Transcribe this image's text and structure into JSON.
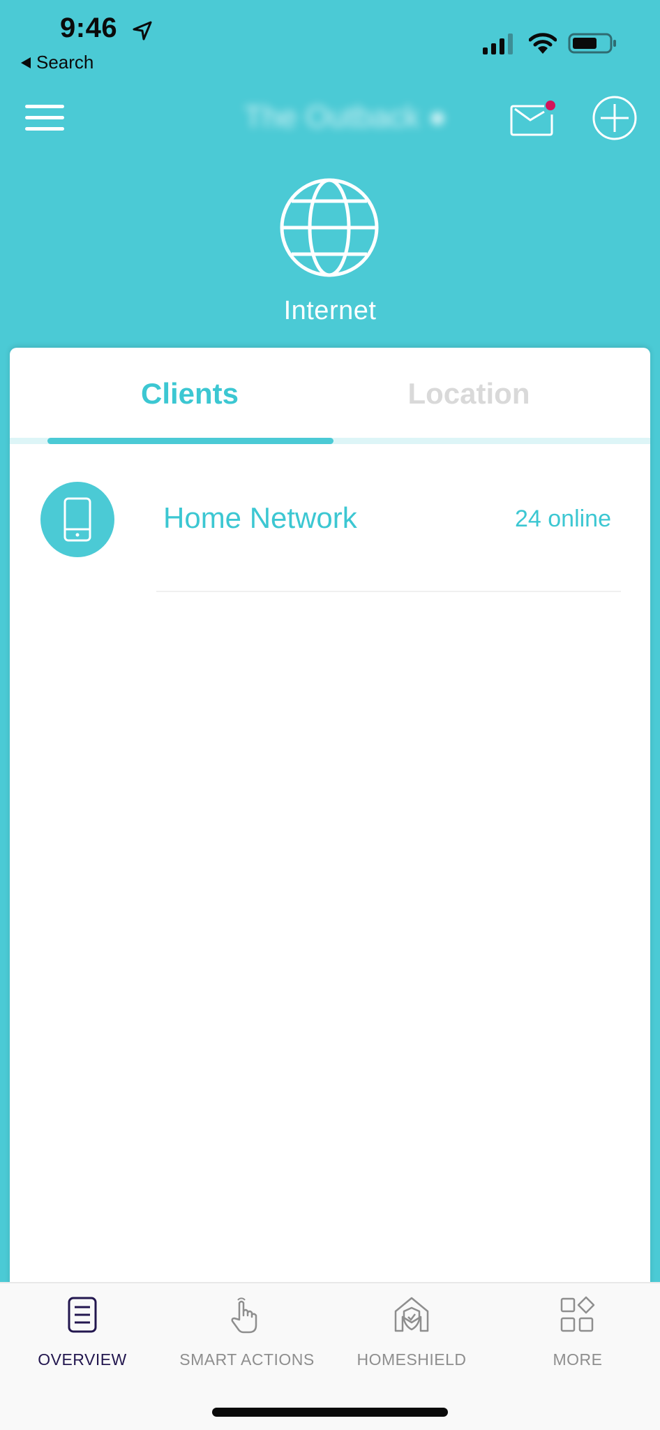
{
  "status_bar": {
    "time": "9:46",
    "back_label": "Search",
    "icons": [
      "location-arrow-icon",
      "cellular-signal-icon",
      "wifi-icon",
      "battery-icon"
    ]
  },
  "nav": {
    "title": "The Outback",
    "title_blurred": true,
    "icons": [
      "hamburger-menu-icon",
      "mail-icon",
      "add-circle-icon"
    ],
    "notification_dot_color": "#d4145a"
  },
  "internet": {
    "label": "Internet",
    "icon": "globe-icon"
  },
  "tabs": [
    {
      "label": "Clients",
      "active": true
    },
    {
      "label": "Location",
      "active": false
    }
  ],
  "networks": [
    {
      "name": "Home Network",
      "status": "24 online",
      "icon": "phone-icon"
    }
  ],
  "tab_bar": {
    "items": [
      {
        "label": "OVERVIEW",
        "icon": "document-list-icon",
        "active": true
      },
      {
        "label": "SMART ACTIONS",
        "icon": "pointer-hand-icon",
        "active": false
      },
      {
        "label": "HOMESHIELD",
        "icon": "house-shield-icon",
        "active": false
      },
      {
        "label": "MORE",
        "icon": "grid-shapes-icon",
        "active": false
      }
    ]
  },
  "colors": {
    "primary": "#4bcad5",
    "accent_text": "#3cc7d2",
    "inactive_tab": "#d9d9d9",
    "active_nav": "#23174f",
    "inactive_nav": "#8e8e8e",
    "notification": "#d4145a"
  }
}
